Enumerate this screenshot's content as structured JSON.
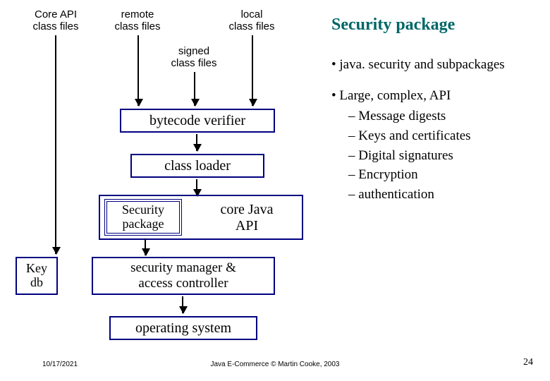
{
  "title": "Security package",
  "bullets": {
    "item1": "java. security and subpackages",
    "item2": "Large, complex, API",
    "sub1": "Message digests",
    "sub2": "Keys and certificates",
    "sub3": "Digital signatures",
    "sub4": "Encryption",
    "sub5": "authentication"
  },
  "diagram": {
    "core_api_l1": "Core API",
    "core_api_l2": "class files",
    "remote_l1": "remote",
    "remote_l2": "class files",
    "local_l1": "local",
    "local_l2": "class files",
    "signed_l1": "signed",
    "signed_l2": "class files",
    "bytecode_verifier": "bytecode verifier",
    "class_loader": "class loader",
    "security_package": "Security package",
    "core_java_api_l1": "core Java",
    "core_java_api_l2": "API",
    "key_db_l1": "Key",
    "key_db_l2": "db",
    "sec_mgr_l1": "security manager &",
    "sec_mgr_l2": "access controller",
    "operating_system": "operating system"
  },
  "footer": {
    "date": "10/17/2021",
    "center": "Java E-Commerce © Martin Cooke, 2003",
    "page": "24"
  }
}
